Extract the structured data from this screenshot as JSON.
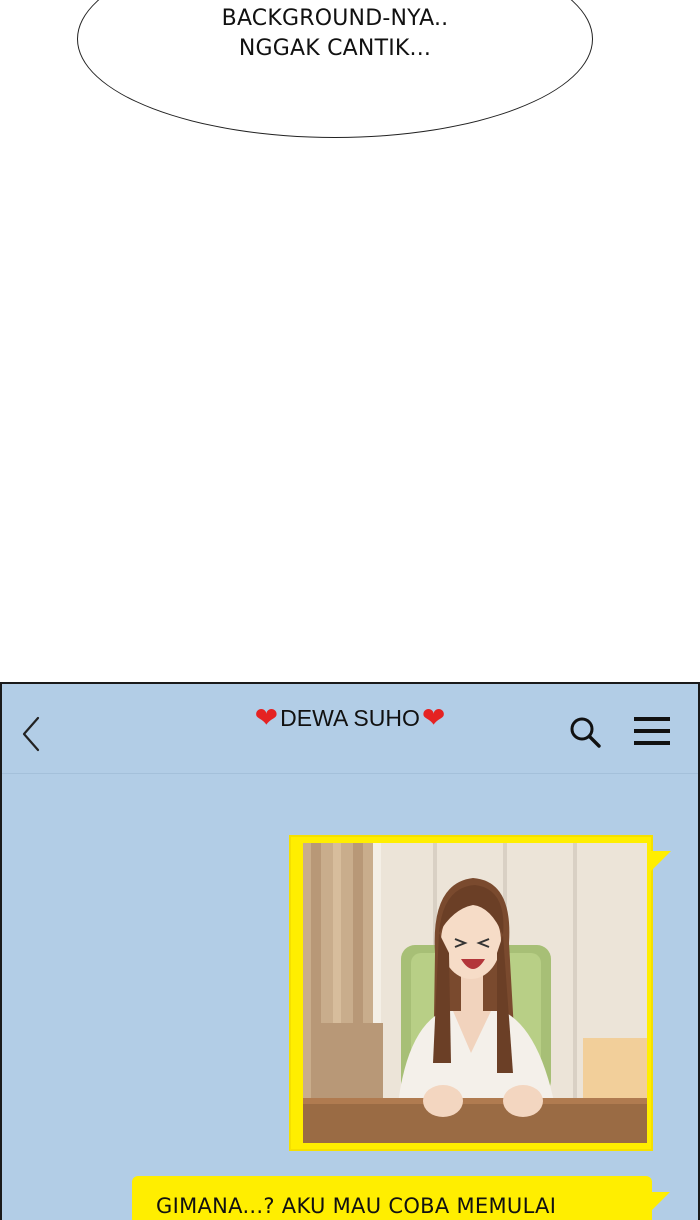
{
  "speech_bubble": {
    "line1": "BACKGROUND-NYA..",
    "line2": "NGGAK CANTIK..."
  },
  "chat": {
    "title": "DEWA SUHO",
    "title_prefix_icon": "red-heart-icon",
    "title_suffix_icon": "red-heart-icon",
    "back_icon": "chevron-left-icon",
    "search_icon": "search-icon",
    "menu_icon": "hamburger-menu-icon",
    "background_color": "#b2cde6",
    "bubble_color": "#ffee00",
    "messages": [
      {
        "type": "image",
        "from": "me",
        "content": "photo of a smiling woman at a desk"
      },
      {
        "type": "text",
        "from": "me",
        "text": "GIMANA...? AKU MAU COBA MEMULAI"
      }
    ]
  }
}
